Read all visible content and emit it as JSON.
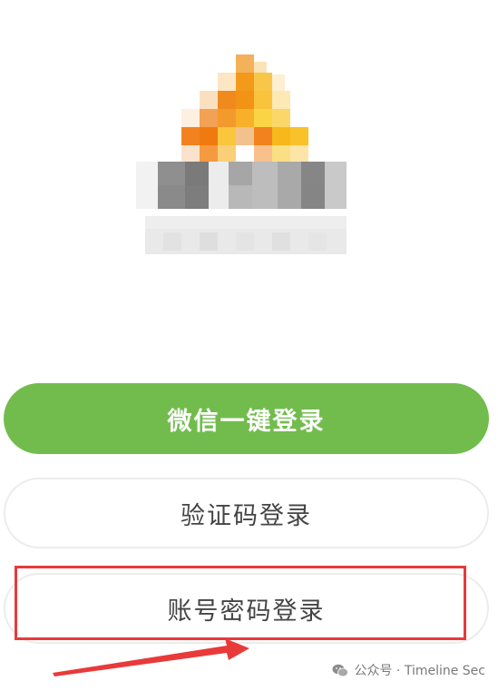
{
  "logo": {
    "icon": "app-logo-pixelated"
  },
  "buttons": {
    "wechat_login": "微信一键登录",
    "sms_login": "验证码登录",
    "password_login": "账号密码登录"
  },
  "annotation": {
    "highlight_color": "#e83a3a",
    "arrow_color": "#e83a3a"
  },
  "watermark": {
    "icon": "wechat-icon",
    "text": "公众号 · Timeline Sec"
  },
  "colors": {
    "wechat_green": "#72bc4e",
    "border_gray": "#ececec",
    "text_dark": "#444444"
  }
}
